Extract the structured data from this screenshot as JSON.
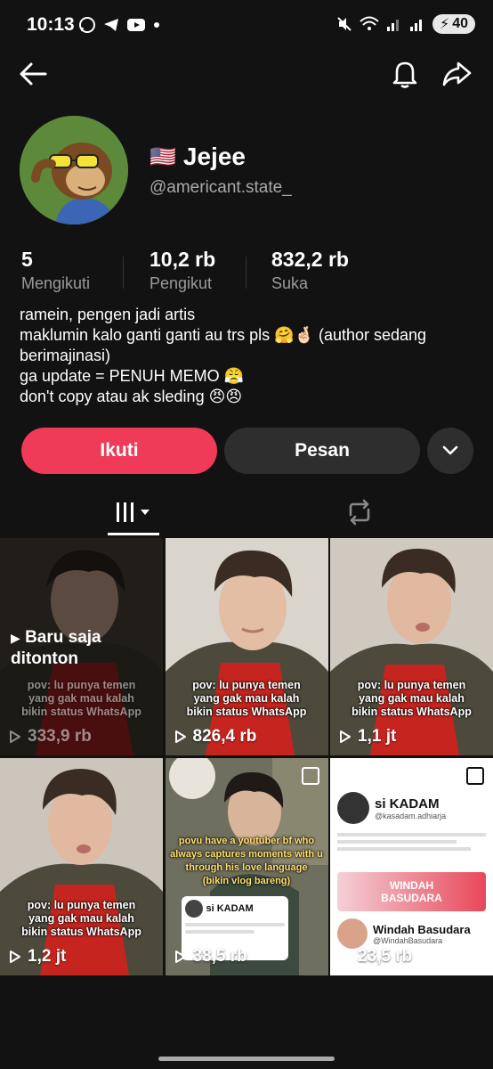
{
  "status_bar": {
    "time": "10:13",
    "battery": "40",
    "icons_left": [
      "whatsapp-icon",
      "telegram-icon",
      "youtube-icon",
      "dot-icon"
    ],
    "icons_right": [
      "mute-icon",
      "wifi-icon",
      "signal-icon",
      "signal-icon",
      "battery-icon"
    ]
  },
  "nav": {
    "back_icon": "back-arrow-icon",
    "bell_icon": "bell-icon",
    "share_icon": "share-icon"
  },
  "profile": {
    "flag": "🇺🇸",
    "name": "Jejee",
    "handle": "@americant.state_"
  },
  "stats": [
    {
      "value": "5",
      "label": "Mengikuti"
    },
    {
      "value": "10,2 rb",
      "label": "Pengikut"
    },
    {
      "value": "832,2 rb",
      "label": "Suka"
    }
  ],
  "bio": [
    "ramein, pengen jadi artis",
    "maklumin kalo ganti ganti au trs pls 🤗🤞🏻 (author sedang",
    "berimajinasi)",
    "ga update = PENUH MEMO 😤",
    "don't copy atau ak sleding 😠😠"
  ],
  "actions": {
    "follow": "Ikuti",
    "message": "Pesan"
  },
  "colors": {
    "accent": "#ef3b57",
    "background": "#121212",
    "button_secondary": "#2e2e2e"
  },
  "tabs": [
    "videos-grid-icon",
    "repost-icon"
  ],
  "videos": [
    {
      "views": "333,9 rb",
      "caption": "pov: lu punya temen\nyang gak mau kalah\nbikin status WhatsApp",
      "badge": "Baru saja\nditonton"
    },
    {
      "views": "826,4 rb",
      "caption": "pov: lu punya temen\nyang gak mau kalah\nbikin status WhatsApp"
    },
    {
      "views": "1,1 jt",
      "caption": "pov: lu punya temen\nyang gak mau kalah\nbikin status WhatsApp"
    },
    {
      "views": "1,2 jt",
      "caption": "pov: lu punya temen\nyang gak mau kalah\nbikin status WhatsApp"
    },
    {
      "views": "38,5 rb",
      "caption": "povu have a youtuber bf who\nalways captures moments with u\nthrough his love language\n(bikin vlog bareng)",
      "card_name": "si KADAM"
    },
    {
      "views": "23,5 rb",
      "card_name": "si KADAM",
      "card_handle": "@kasadam.adhiarja",
      "card_name2": "Windah Basudara",
      "card_handle2": "@WindahBasudara",
      "banner": "WINDAH\nBASUDARA"
    }
  ]
}
